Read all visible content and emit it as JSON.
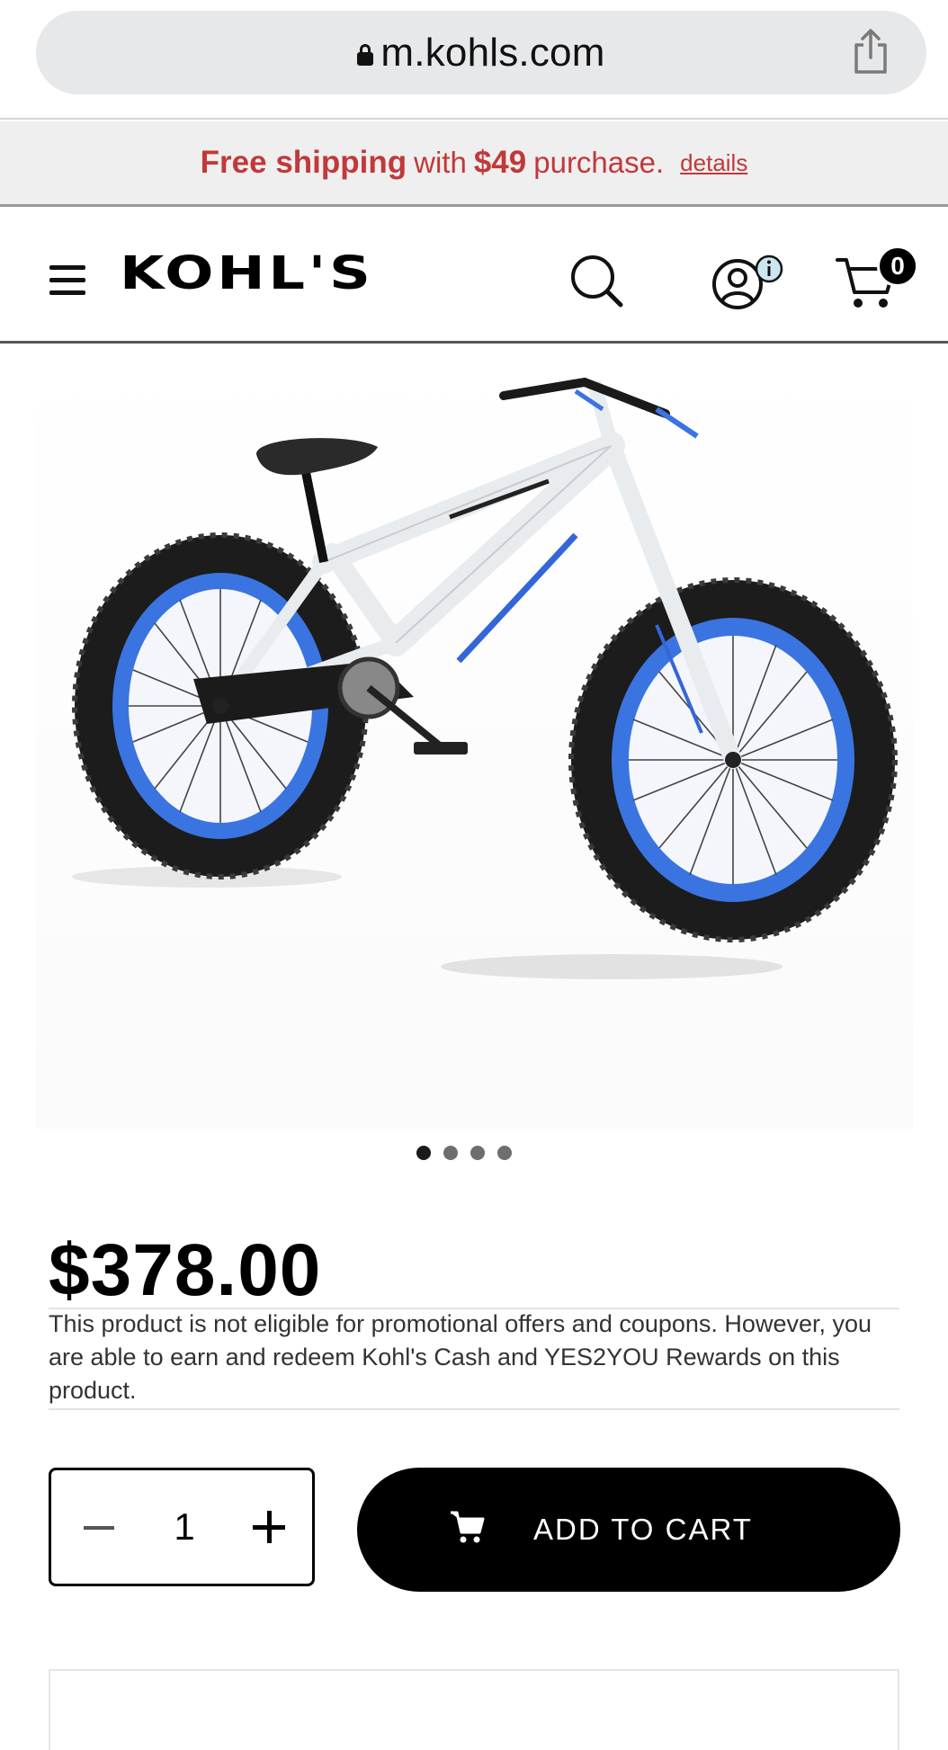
{
  "browser": {
    "url": "m.kohls.com",
    "lock_icon": "lock-icon",
    "share_icon": "share-icon"
  },
  "promo": {
    "free_shipping": "Free shipping",
    "with": "with",
    "amount": "$49",
    "purchase": "purchase.",
    "details": "details",
    "color": "#c0393b"
  },
  "header": {
    "logo": "KOHL'S",
    "menu_icon": "hamburger-menu-icon",
    "search_icon": "search-icon",
    "account_icon": "account-icon",
    "cart_icon": "cart-icon",
    "cart_count": "0"
  },
  "product": {
    "image_alt": "white fat tire bike with blue rims",
    "carousel_dots": 4,
    "carousel_active": 1,
    "price": "$378.00",
    "note": "This product is not eligible for promotional offers and coupons. However, you are able to earn and redeem Kohl's Cash and YES2YOU Rewards on this product."
  },
  "purchase": {
    "quantity": "1",
    "minus_icon": "minus-icon",
    "plus_icon": "plus-icon",
    "add_to_cart": "ADD TO CART"
  }
}
